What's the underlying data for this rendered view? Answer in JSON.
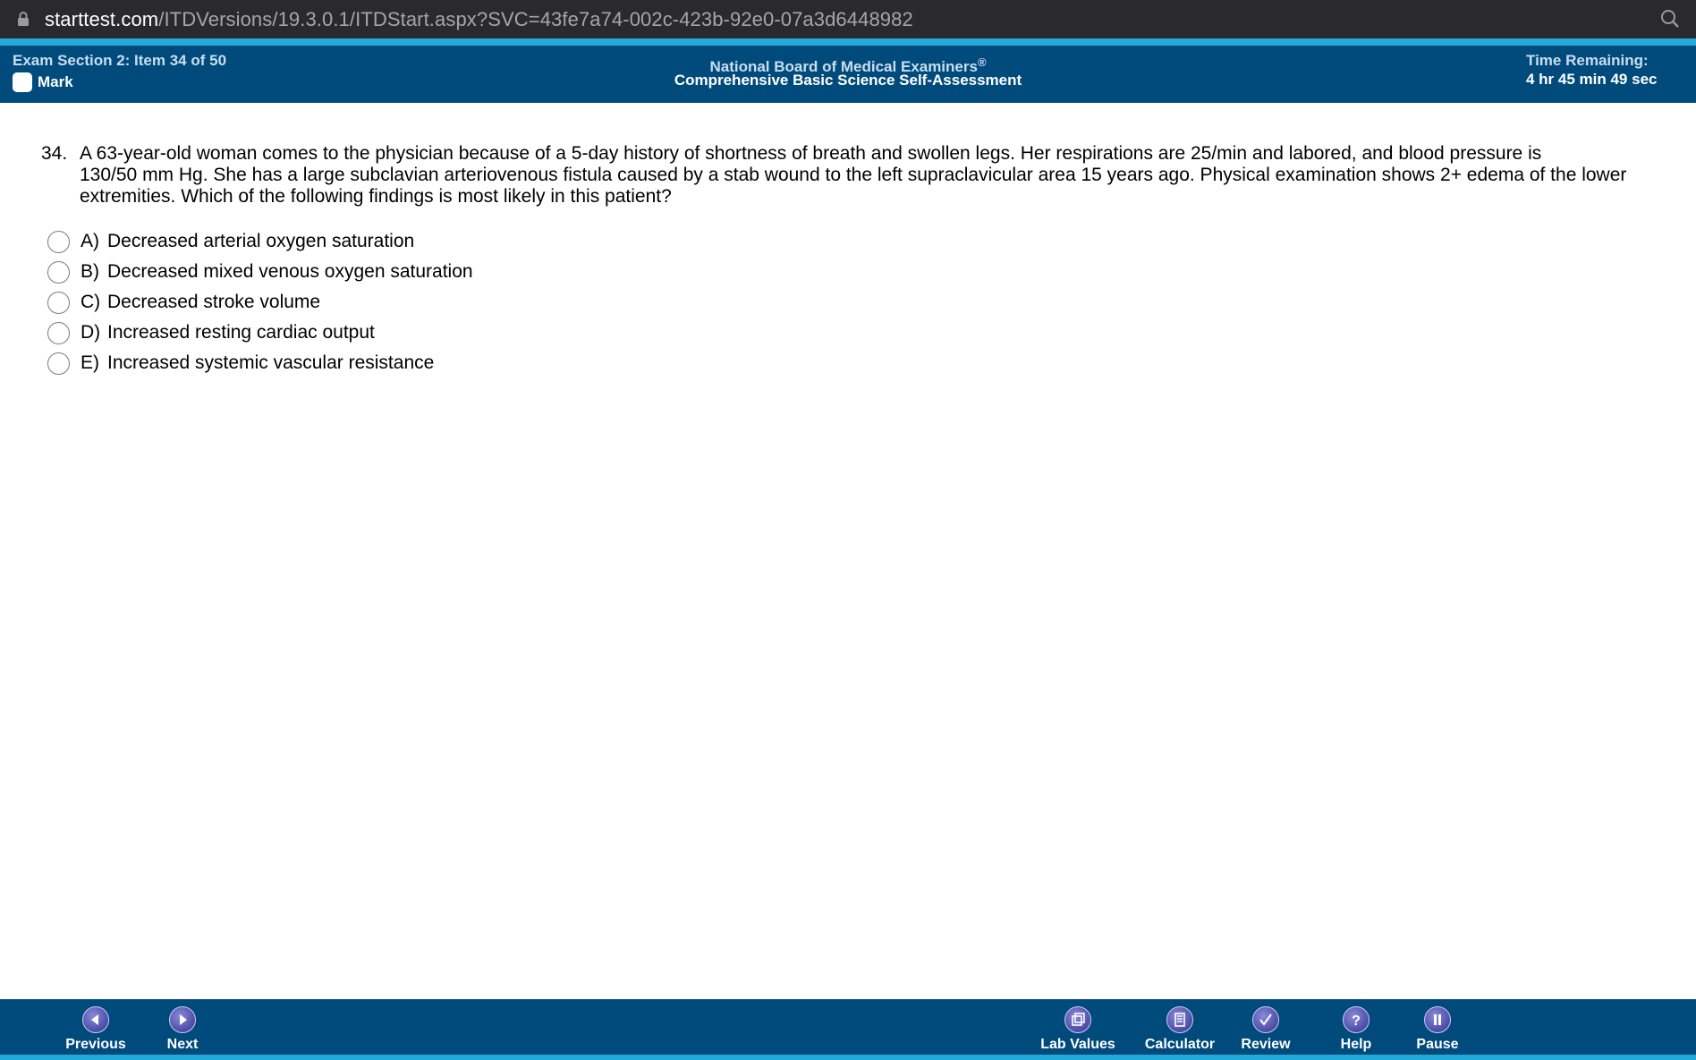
{
  "browser": {
    "url_host": "starttest.com",
    "url_path": "/ITDVersions/19.3.0.1/ITDStart.aspx?SVC=43fe7a74-002c-423b-92e0-07a3d6448982"
  },
  "header": {
    "section_item": "Exam Section 2: Item 34 of 50",
    "mark_label": "Mark",
    "org_title": "National Board of Medical Examiners",
    "org_reg": "®",
    "exam_title": "Comprehensive Basic Science Self-Assessment",
    "time_label": "Time Remaining:",
    "time_value": "4 hr 45 min 49 sec"
  },
  "question": {
    "number": "34.",
    "lines": [
      "A 63-year-old woman comes to the physician because of a 5-day history of shortness of breath and swollen legs. Her respirations are 25/min and labored, and blood pressure is",
      "130/50 mm Hg. She has a large subclavian arteriovenous fistula caused by a stab wound to the left supraclavicular area 15 years ago. Physical examination shows 2+ edema of the lower",
      "extremities. Which of the following findings is most likely in this patient?"
    ],
    "choices": [
      {
        "letter": "A)",
        "text": "Decreased arterial oxygen saturation"
      },
      {
        "letter": "B)",
        "text": "Decreased mixed venous oxygen saturation"
      },
      {
        "letter": "C)",
        "text": "Decreased stroke volume"
      },
      {
        "letter": "D)",
        "text": "Increased resting cardiac output"
      },
      {
        "letter": "E)",
        "text": "Increased systemic vascular resistance"
      }
    ]
  },
  "toolbar": {
    "previous": "Previous",
    "next": "Next",
    "lab_values": "Lab Values",
    "calculator": "Calculator",
    "review": "Review",
    "help": "Help",
    "pause": "Pause"
  }
}
